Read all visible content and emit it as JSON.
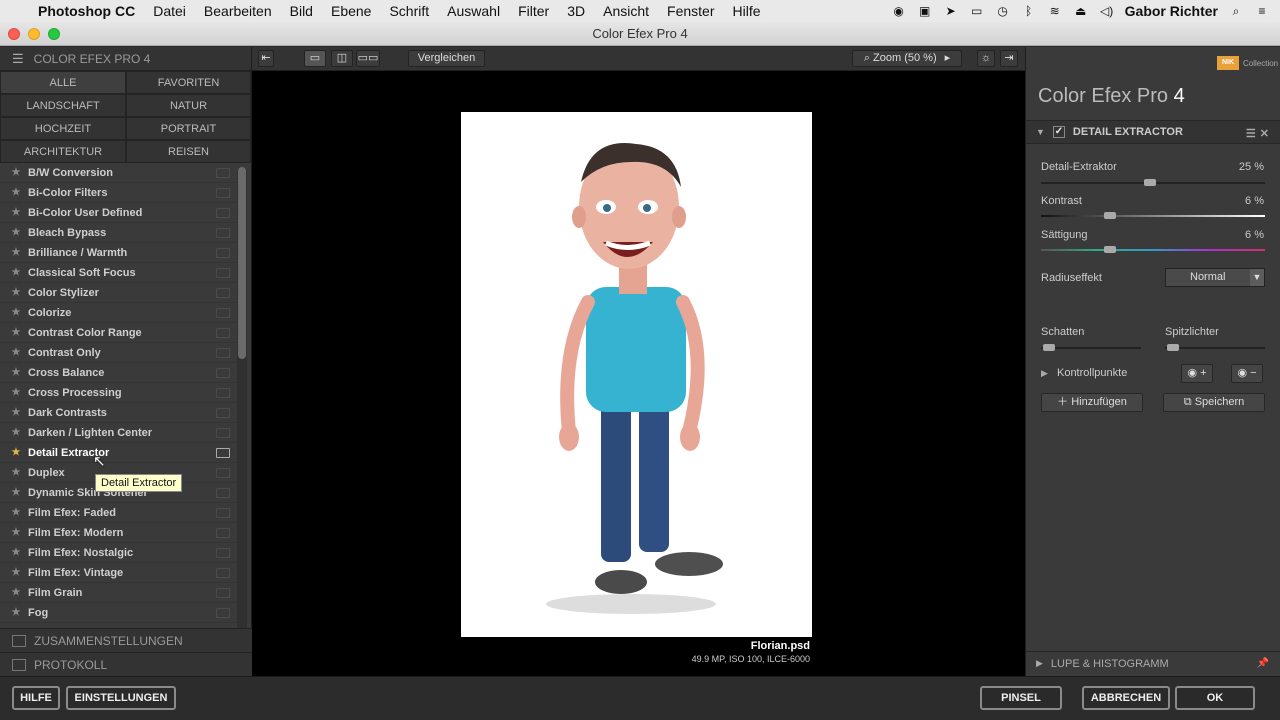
{
  "menubar": {
    "app_name": "Photoshop CC",
    "items": [
      "Datei",
      "Bearbeiten",
      "Bild",
      "Ebene",
      "Schrift",
      "Auswahl",
      "Filter",
      "3D",
      "Ansicht",
      "Fenster",
      "Hilfe"
    ],
    "user": "Gabor Richter"
  },
  "window": {
    "title": "Color Efex Pro 4"
  },
  "left_panel": {
    "header": "COLOR EFEX PRO 4",
    "categories": [
      "ALLE",
      "FAVORITEN",
      "LANDSCHAFT",
      "NATUR",
      "HOCHZEIT",
      "PORTRAIT",
      "ARCHITEKTUR",
      "REISEN"
    ],
    "filters": [
      "B/W Conversion",
      "Bi-Color Filters",
      "Bi-Color User Defined",
      "Bleach Bypass",
      "Brilliance / Warmth",
      "Classical Soft Focus",
      "Color Stylizer",
      "Colorize",
      "Contrast Color Range",
      "Contrast Only",
      "Cross Balance",
      "Cross Processing",
      "Dark Contrasts",
      "Darken / Lighten Center",
      "Detail Extractor",
      "Duplex",
      "Dynamic Skin Softener",
      "Film Efex: Faded",
      "Film Efex: Modern",
      "Film Efex: Nostalgic",
      "Film Efex: Vintage",
      "Film Grain",
      "Fog"
    ],
    "active_filter": "Detail Extractor",
    "tooltip": "Detail Extractor",
    "section1": "ZUSAMMENSTELLUNGEN",
    "section2": "PROTOKOLL"
  },
  "toolbar": {
    "compare_label": "Vergleichen",
    "zoom_label": "Zoom (50 %)"
  },
  "image": {
    "filename": "Florian.psd",
    "info": "49.9 MP, ISO 100, ILCE-6000"
  },
  "right_panel": {
    "badge": "NIK",
    "collection": "Collection",
    "brand_name": "Color Efex Pro",
    "brand_version": "4",
    "filter_title": "DETAIL EXTRACTOR",
    "sliders": [
      {
        "label": "Detail-Extraktor",
        "value": "25 %",
        "level": 25
      },
      {
        "label": "Kontrast",
        "value": "6 %",
        "level": 6
      },
      {
        "label": "Sättigung",
        "value": "6 %",
        "level": 6
      }
    ],
    "radius_label": "Radiuseffekt",
    "radius_value": "Normal",
    "shadows_label": "Schatten",
    "highlights_label": "Spitzlichter",
    "controlpoints_label": "Kontrollpunkte",
    "add_label": "Hinzufügen",
    "save_label": "Speichern",
    "lupe_label": "LUPE & HISTOGRAMM"
  },
  "bottom": {
    "help": "HILFE",
    "settings": "EINSTELLUNGEN",
    "brush": "PINSEL",
    "cancel": "ABBRECHEN",
    "ok": "OK"
  }
}
